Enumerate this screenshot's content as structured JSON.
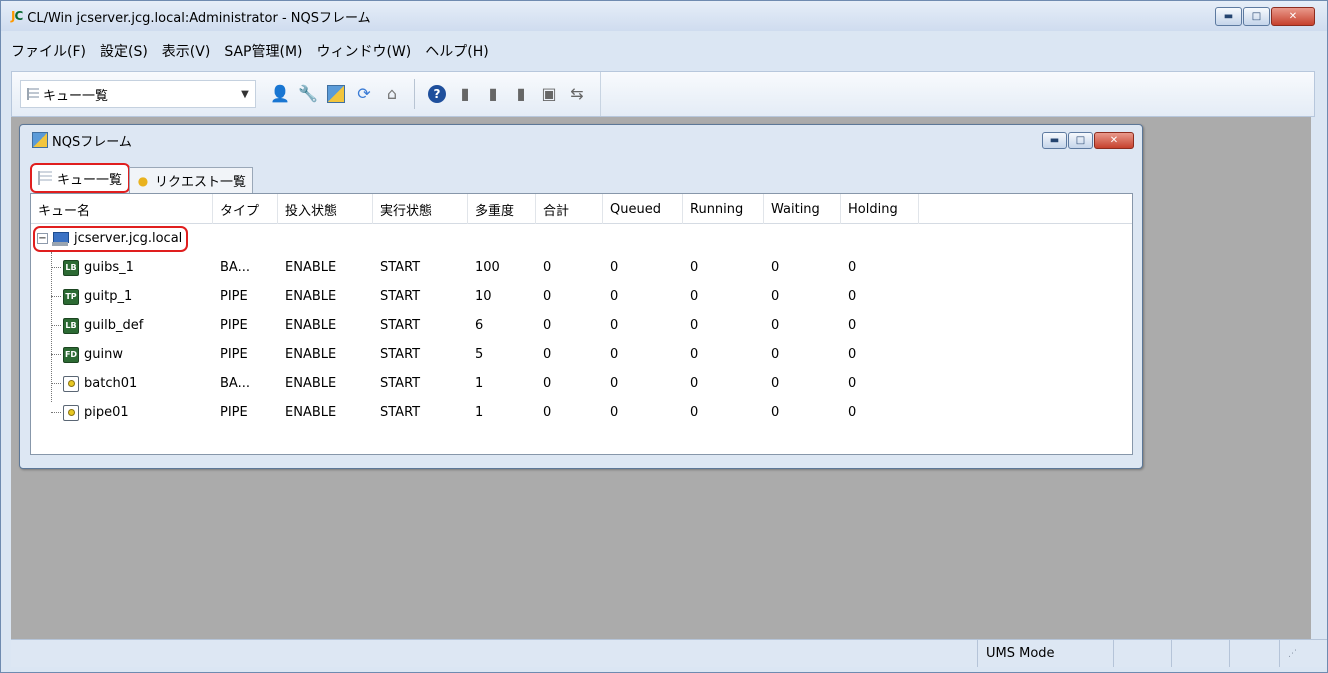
{
  "window": {
    "logo_j": "J",
    "logo_c": "C",
    "title": "CL/Win jcserver.jcg.local:Administrator - NQSフレーム"
  },
  "menubar": {
    "items": [
      "ファイル(F)",
      "設定(S)",
      "表示(V)",
      "SAP管理(M)",
      "ウィンドウ(W)",
      "ヘルプ(H)"
    ]
  },
  "toolbar": {
    "view_combo_value": "キュー一覧",
    "icons": [
      "user-icon",
      "tools-icon",
      "nqs-frame-icon",
      "refresh-icon",
      "home-icon",
      "help-icon",
      "doc-icon",
      "doc2-icon",
      "doc3-icon",
      "job-icon",
      "transfer-icon"
    ]
  },
  "child_window": {
    "title": "NQSフレーム",
    "tabs": [
      {
        "label": "キュー一覧",
        "active": true
      },
      {
        "label": "リクエスト一覧",
        "active": false
      }
    ]
  },
  "table": {
    "columns": [
      "キュー名",
      "タイプ",
      "投入状態",
      "実行状態",
      "多重度",
      "合計",
      "Queued",
      "Running",
      "Waiting",
      "Holding"
    ],
    "server": "jcserver.jcg.local",
    "rows": [
      {
        "name": "guibs_1",
        "type": "BA...",
        "submit": "ENABLE",
        "run": "START",
        "multi": "100",
        "total": "0",
        "queued": "0",
        "running": "0",
        "waiting": "0",
        "holding": "0",
        "icon": "LB"
      },
      {
        "name": "guitp_1",
        "type": "PIPE",
        "submit": "ENABLE",
        "run": "START",
        "multi": "10",
        "total": "0",
        "queued": "0",
        "running": "0",
        "waiting": "0",
        "holding": "0",
        "icon": "TP"
      },
      {
        "name": "guilb_def",
        "type": "PIPE",
        "submit": "ENABLE",
        "run": "START",
        "multi": "6",
        "total": "0",
        "queued": "0",
        "running": "0",
        "waiting": "0",
        "holding": "0",
        "icon": "LB"
      },
      {
        "name": "guinw",
        "type": "PIPE",
        "submit": "ENABLE",
        "run": "START",
        "multi": "5",
        "total": "0",
        "queued": "0",
        "running": "0",
        "waiting": "0",
        "holding": "0",
        "icon": "FD"
      },
      {
        "name": "batch01",
        "type": "BA...",
        "submit": "ENABLE",
        "run": "START",
        "multi": "1",
        "total": "0",
        "queued": "0",
        "running": "0",
        "waiting": "0",
        "holding": "0",
        "icon": "req"
      },
      {
        "name": "pipe01",
        "type": "PIPE",
        "submit": "ENABLE",
        "run": "START",
        "multi": "1",
        "total": "0",
        "queued": "0",
        "running": "0",
        "waiting": "0",
        "holding": "0",
        "icon": "req"
      }
    ]
  },
  "statusbar": {
    "main": "",
    "mode": "UMS Mode"
  }
}
